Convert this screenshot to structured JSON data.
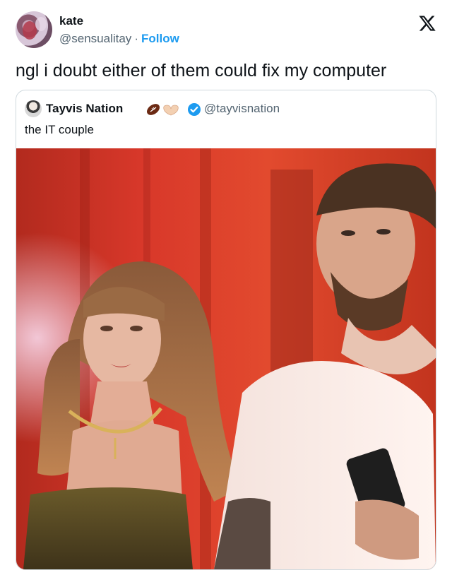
{
  "author": {
    "name": "kate",
    "handle": "@sensualitay",
    "separator": "·",
    "follow_label": "Follow"
  },
  "tweet": {
    "text": "ngl i doubt either of them could fix my computer"
  },
  "quote": {
    "author_name": "Tayvis Nation",
    "author_handle": "@tayvisnation",
    "text": "the IT couple"
  },
  "icons": {
    "logo": "x-logo-icon",
    "football": "football-emoji-icon",
    "heart_hands": "heart-hands-emoji-icon",
    "verified": "verified-badge-icon"
  },
  "colors": {
    "accent": "#1d9bf0",
    "secondary_text": "#536471",
    "border": "#cfd9de"
  }
}
